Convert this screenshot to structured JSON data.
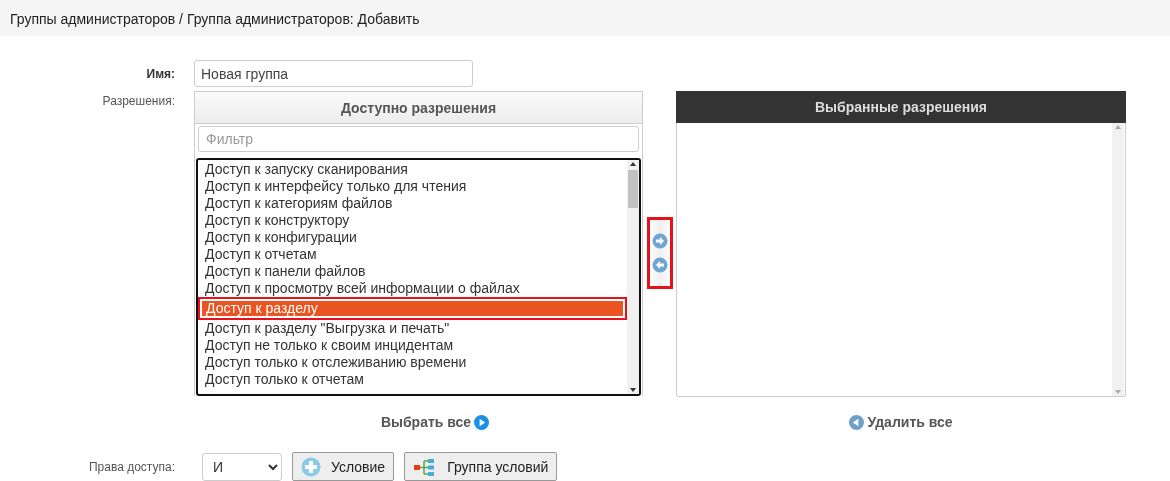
{
  "header": {
    "breadcrumb": "Группы администраторов / Группа администраторов: Добавить"
  },
  "form": {
    "name_label": "Имя:",
    "name_value": "Новая группа",
    "permissions_label": "Разрешения:",
    "available": {
      "title": "Доступно разрешения",
      "filter_placeholder": "Фильтр",
      "items": [
        {
          "label": "Доступ к запуску сканирования",
          "selected": false
        },
        {
          "label": "Доступ к интерфейсу только для чтения",
          "selected": false
        },
        {
          "label": "Доступ к категориям файлов",
          "selected": false
        },
        {
          "label": "Доступ к конструктору",
          "selected": false
        },
        {
          "label": "Доступ к конфигурации",
          "selected": false
        },
        {
          "label": "Доступ к отчетам",
          "selected": false
        },
        {
          "label": "Доступ к панели файлов",
          "selected": false
        },
        {
          "label": "Доступ к просмотру всей информации о файлах",
          "selected": false
        },
        {
          "label": "Доступ к разделу",
          "selected": true
        },
        {
          "label": "Доступ к разделу \"Выгрузка и печать\"",
          "selected": false
        },
        {
          "label": "Доступ не только к своим инцидентам",
          "selected": false
        },
        {
          "label": "Доступ только к отслеживанию времени",
          "selected": false
        },
        {
          "label": "Доступ только к отчетам",
          "selected": false
        }
      ]
    },
    "chosen": {
      "title": "Выбранные разрешения"
    },
    "select_all": "Выбрать все",
    "remove_all": "Удалить все",
    "access": {
      "label": "Права доступа:",
      "operator": "И",
      "buttons": [
        {
          "label": "Условие",
          "kind": "condition"
        },
        {
          "label": "Группа условий",
          "kind": "group"
        }
      ]
    }
  }
}
